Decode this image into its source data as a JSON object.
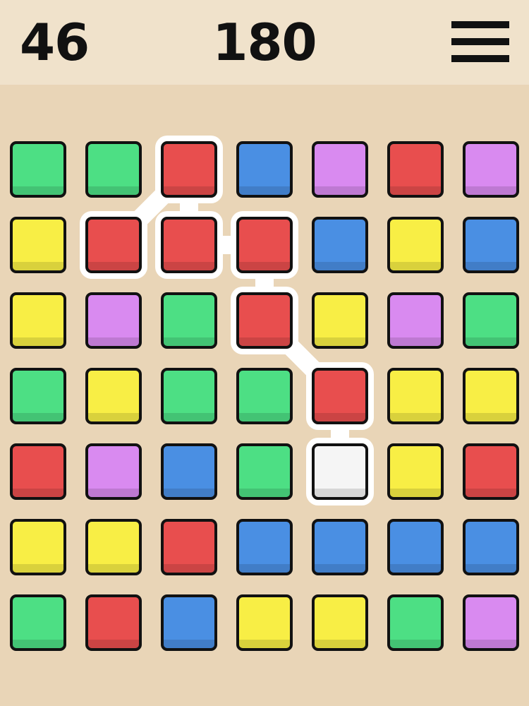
{
  "header": {
    "moves": "46",
    "score": "180",
    "menu_icon": "hamburger-menu-icon"
  },
  "colors": {
    "green": "#4ddf84",
    "red": "#e84e4e",
    "blue": "#4a8fe3",
    "purple": "#d98af0",
    "yellow": "#f8ee45",
    "white": "#f5f5f5",
    "background": "#e9d5b7",
    "header_background": "#f0e2cb",
    "selection": "#ffffff"
  },
  "board": {
    "rows": 7,
    "cols": 7,
    "grid": [
      [
        "green",
        "green",
        "red",
        "blue",
        "purple",
        "red",
        "purple"
      ],
      [
        "yellow",
        "red",
        "red",
        "red",
        "blue",
        "yellow",
        "blue"
      ],
      [
        "yellow",
        "purple",
        "green",
        "red",
        "yellow",
        "purple",
        "green"
      ],
      [
        "green",
        "yellow",
        "green",
        "green",
        "red",
        "yellow",
        "yellow"
      ],
      [
        "red",
        "purple",
        "blue",
        "green",
        "white",
        "yellow",
        "red"
      ],
      [
        "yellow",
        "yellow",
        "red",
        "blue",
        "blue",
        "blue",
        "blue"
      ],
      [
        "green",
        "red",
        "blue",
        "yellow",
        "yellow",
        "green",
        "purple"
      ]
    ],
    "selected_path": [
      [
        1,
        1
      ],
      [
        0,
        2
      ],
      [
        1,
        2
      ],
      [
        1,
        3
      ],
      [
        2,
        3
      ],
      [
        3,
        4
      ],
      [
        4,
        4
      ]
    ]
  }
}
